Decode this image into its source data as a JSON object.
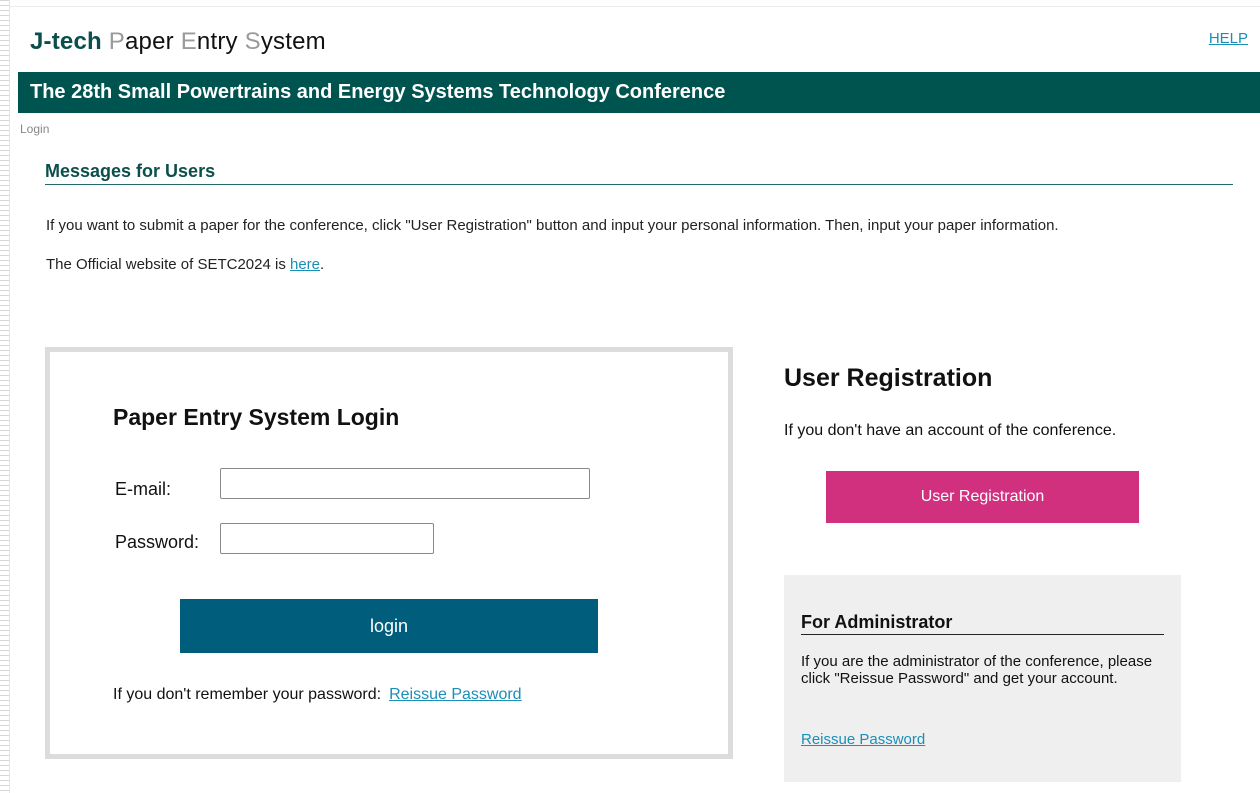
{
  "header": {
    "logo_brand": "J-tech",
    "logo_p": "P",
    "logo_aper": "aper ",
    "logo_e": "E",
    "logo_ntry": "ntry ",
    "logo_s": "S",
    "logo_ystem": "ystem",
    "help_label": "HELP"
  },
  "conference": {
    "title": "The 28th Small Powertrains and Energy Systems Technology Conference"
  },
  "breadcrumb": "Login",
  "messages": {
    "title": "Messages for Users",
    "line1": "If you want to submit a paper for the conference, click \"User Registration\" button and input your personal information. Then, input your paper information.",
    "line2_prefix": "The Official website of SETC2024 is ",
    "line2_link": "here",
    "line2_suffix": "."
  },
  "login": {
    "title": "Paper Entry System Login",
    "email_label": "E-mail:",
    "email_value": "",
    "password_label": "Password:",
    "password_value": "",
    "button_label": "login",
    "forgot_text": "If you don't remember your password:",
    "reissue_link": "Reissue Password"
  },
  "registration": {
    "title": "User Registration",
    "text": "If you don't have an account of the conference.",
    "button_label": "User Registration"
  },
  "admin": {
    "title": "For Administrator",
    "text": "If you are the administrator of the conference, please click \"Reissue Password\" and get your account.",
    "link": "Reissue Password"
  },
  "colors": {
    "brand_green": "#005450",
    "login_button": "#005d7b",
    "registration_button": "#d1307f",
    "link": "#1a8fb8"
  }
}
